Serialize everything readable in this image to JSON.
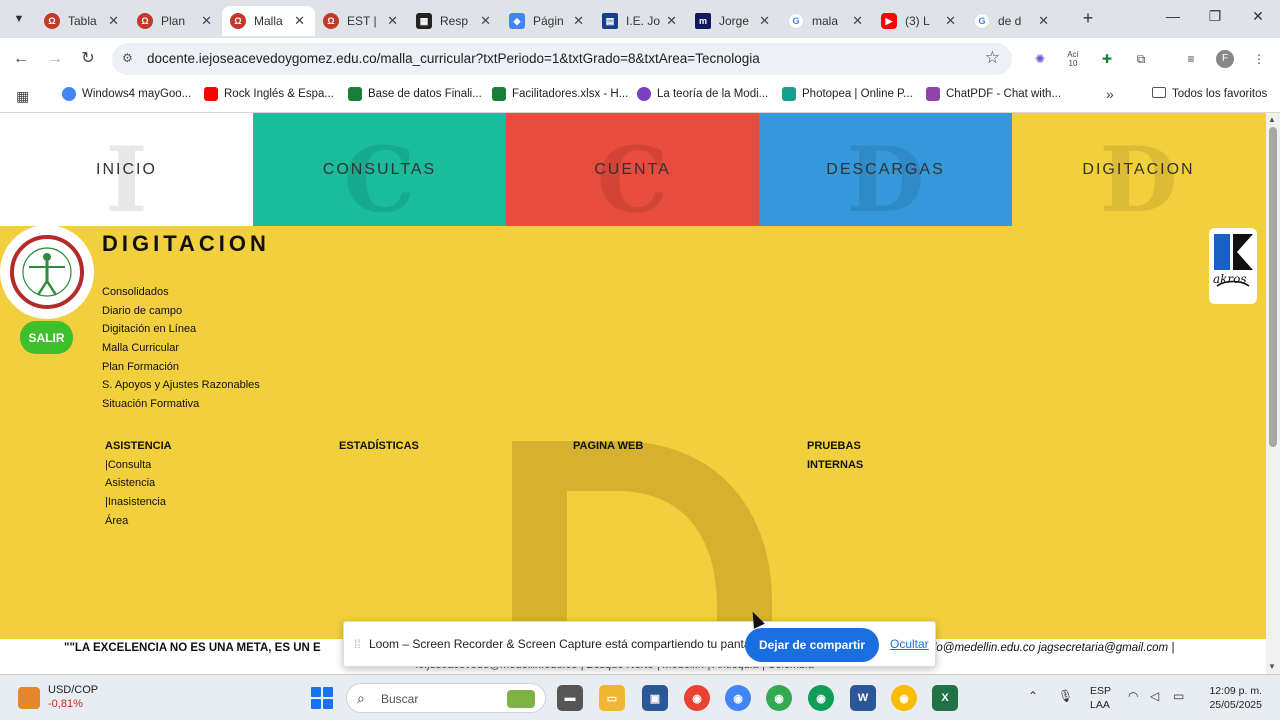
{
  "browser": {
    "tabs": [
      {
        "title": "Tabla",
        "favicon_color": "#c0392b",
        "active": false
      },
      {
        "title": "Plan",
        "favicon_color": "#c0392b",
        "active": false
      },
      {
        "title": "Malla",
        "favicon_color": "#c0392b",
        "active": true
      },
      {
        "title": "EST |",
        "favicon_color": "#c0392b",
        "active": false
      },
      {
        "title": "Resp",
        "favicon_color": "#222222",
        "active": false
      },
      {
        "title": "Págin",
        "favicon_color": "#4285f4",
        "active": false
      },
      {
        "title": "I.E. Jo",
        "favicon_color": "#1a3c8c",
        "active": false
      },
      {
        "title": "Jorge",
        "favicon_color": "#0d1a5c",
        "active": false
      },
      {
        "title": "mala",
        "favicon_color": "#4285f4",
        "active": false
      },
      {
        "title": "(3) L",
        "favicon_color": "#ff0000",
        "active": false
      },
      {
        "title": "de d",
        "favicon_color": "#4285f4",
        "active": false
      }
    ],
    "url": "docente.iejoseacevedoygomez.edu.co/malla_curricular?txtPeriodo=1&txtGrado=8&txtArea=Tecnologia",
    "bookmarks": [
      {
        "label": "Windows4 mayGoo...",
        "icon_color": "#4285f4"
      },
      {
        "label": "Rock Inglés & Espa...",
        "icon_color": "#ff0000"
      },
      {
        "label": "Base de datos Finali...",
        "icon_color": "#188038"
      },
      {
        "label": "Facilitadores.xlsx - H...",
        "icon_color": "#188038"
      },
      {
        "label": "La teoría de la Modi...",
        "icon_color": "#7b3fbf"
      },
      {
        "label": "Photopea | Online P...",
        "icon_color": "#1a9e8f"
      },
      {
        "label": "ChatPDF - Chat with...",
        "icon_color": "#8e44ad"
      }
    ],
    "all_bookmarks": "Todos los favoritos",
    "ext_label": "Ací 10"
  },
  "site": {
    "nav": [
      {
        "label": "INICIO",
        "ghost": "I",
        "color": "#ffffff"
      },
      {
        "label": "CONSULTAS",
        "ghost": "C",
        "color": "#1abc9c"
      },
      {
        "label": "CUENTA",
        "ghost": "C",
        "color": "#e74c3c"
      },
      {
        "label": "DESCARGAS",
        "ghost": "D",
        "color": "#3498db"
      },
      {
        "label": "DIGITACION",
        "ghost": "D",
        "color": "#f2cf3c"
      }
    ],
    "title": "DIGITACION",
    "salir": "SALIR",
    "menu": [
      "Consolidados",
      "Diario de campo",
      "Digitación en Línea",
      "Malla Curricular",
      "Plan Formación",
      "S. Apoyos y Ajustes Razonables",
      "Situación Formativa"
    ],
    "columns": [
      {
        "head": "ASISTENCIA",
        "items": [
          "|Consulta",
          "Asistencia",
          "|Inasistencia",
          "Área"
        ]
      },
      {
        "head": "ESTADÍSTICAS",
        "items": []
      },
      {
        "head": "PAGINA WEB",
        "items": []
      },
      {
        "head": "PRUEBAS INTERNAS",
        "items": []
      }
    ],
    "akros_text": "akros",
    "footer_line1": "\"\"LA EXCELENCIA NO ES UNA META, ES UN E",
    "footer_line1_right": "do@medellin.edu.co jagsecretaria@gmail.com |",
    "footer_line2": "ie.joseacevedo@medellin.edu.co | Bosque Norte | Medellín | Antioquia | Colombia"
  },
  "loom": {
    "message": "Loom – Screen Recorder & Screen Capture está compartiendo tu pantalla.",
    "stop_label": "Dejar de compartir",
    "hide_label": "Ocultar"
  },
  "taskbar": {
    "ticker": "USD/COP",
    "change": "-0,81%",
    "search_placeholder": "Buscar",
    "lang1": "ESP",
    "lang2": "LAA",
    "time": "12:09 p. m.",
    "date": "25/05/2025"
  }
}
